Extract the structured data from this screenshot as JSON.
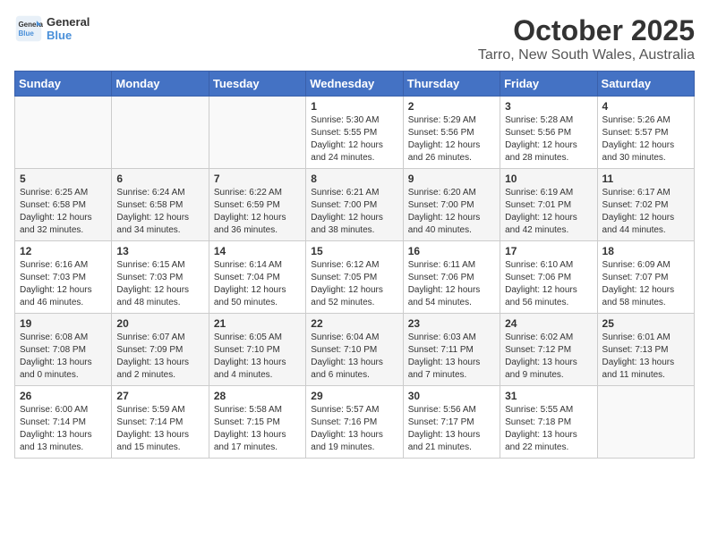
{
  "logo": {
    "text_general": "General",
    "text_blue": "Blue"
  },
  "title": "October 2025",
  "subtitle": "Tarro, New South Wales, Australia",
  "days_of_week": [
    "Sunday",
    "Monday",
    "Tuesday",
    "Wednesday",
    "Thursday",
    "Friday",
    "Saturday"
  ],
  "weeks": [
    [
      {
        "day": "",
        "info": ""
      },
      {
        "day": "",
        "info": ""
      },
      {
        "day": "",
        "info": ""
      },
      {
        "day": "1",
        "info": "Sunrise: 5:30 AM\nSunset: 5:55 PM\nDaylight: 12 hours\nand 24 minutes."
      },
      {
        "day": "2",
        "info": "Sunrise: 5:29 AM\nSunset: 5:56 PM\nDaylight: 12 hours\nand 26 minutes."
      },
      {
        "day": "3",
        "info": "Sunrise: 5:28 AM\nSunset: 5:56 PM\nDaylight: 12 hours\nand 28 minutes."
      },
      {
        "day": "4",
        "info": "Sunrise: 5:26 AM\nSunset: 5:57 PM\nDaylight: 12 hours\nand 30 minutes."
      }
    ],
    [
      {
        "day": "5",
        "info": "Sunrise: 6:25 AM\nSunset: 6:58 PM\nDaylight: 12 hours\nand 32 minutes."
      },
      {
        "day": "6",
        "info": "Sunrise: 6:24 AM\nSunset: 6:58 PM\nDaylight: 12 hours\nand 34 minutes."
      },
      {
        "day": "7",
        "info": "Sunrise: 6:22 AM\nSunset: 6:59 PM\nDaylight: 12 hours\nand 36 minutes."
      },
      {
        "day": "8",
        "info": "Sunrise: 6:21 AM\nSunset: 7:00 PM\nDaylight: 12 hours\nand 38 minutes."
      },
      {
        "day": "9",
        "info": "Sunrise: 6:20 AM\nSunset: 7:00 PM\nDaylight: 12 hours\nand 40 minutes."
      },
      {
        "day": "10",
        "info": "Sunrise: 6:19 AM\nSunset: 7:01 PM\nDaylight: 12 hours\nand 42 minutes."
      },
      {
        "day": "11",
        "info": "Sunrise: 6:17 AM\nSunset: 7:02 PM\nDaylight: 12 hours\nand 44 minutes."
      }
    ],
    [
      {
        "day": "12",
        "info": "Sunrise: 6:16 AM\nSunset: 7:03 PM\nDaylight: 12 hours\nand 46 minutes."
      },
      {
        "day": "13",
        "info": "Sunrise: 6:15 AM\nSunset: 7:03 PM\nDaylight: 12 hours\nand 48 minutes."
      },
      {
        "day": "14",
        "info": "Sunrise: 6:14 AM\nSunset: 7:04 PM\nDaylight: 12 hours\nand 50 minutes."
      },
      {
        "day": "15",
        "info": "Sunrise: 6:12 AM\nSunset: 7:05 PM\nDaylight: 12 hours\nand 52 minutes."
      },
      {
        "day": "16",
        "info": "Sunrise: 6:11 AM\nSunset: 7:06 PM\nDaylight: 12 hours\nand 54 minutes."
      },
      {
        "day": "17",
        "info": "Sunrise: 6:10 AM\nSunset: 7:06 PM\nDaylight: 12 hours\nand 56 minutes."
      },
      {
        "day": "18",
        "info": "Sunrise: 6:09 AM\nSunset: 7:07 PM\nDaylight: 12 hours\nand 58 minutes."
      }
    ],
    [
      {
        "day": "19",
        "info": "Sunrise: 6:08 AM\nSunset: 7:08 PM\nDaylight: 13 hours\nand 0 minutes."
      },
      {
        "day": "20",
        "info": "Sunrise: 6:07 AM\nSunset: 7:09 PM\nDaylight: 13 hours\nand 2 minutes."
      },
      {
        "day": "21",
        "info": "Sunrise: 6:05 AM\nSunset: 7:10 PM\nDaylight: 13 hours\nand 4 minutes."
      },
      {
        "day": "22",
        "info": "Sunrise: 6:04 AM\nSunset: 7:10 PM\nDaylight: 13 hours\nand 6 minutes."
      },
      {
        "day": "23",
        "info": "Sunrise: 6:03 AM\nSunset: 7:11 PM\nDaylight: 13 hours\nand 7 minutes."
      },
      {
        "day": "24",
        "info": "Sunrise: 6:02 AM\nSunset: 7:12 PM\nDaylight: 13 hours\nand 9 minutes."
      },
      {
        "day": "25",
        "info": "Sunrise: 6:01 AM\nSunset: 7:13 PM\nDaylight: 13 hours\nand 11 minutes."
      }
    ],
    [
      {
        "day": "26",
        "info": "Sunrise: 6:00 AM\nSunset: 7:14 PM\nDaylight: 13 hours\nand 13 minutes."
      },
      {
        "day": "27",
        "info": "Sunrise: 5:59 AM\nSunset: 7:14 PM\nDaylight: 13 hours\nand 15 minutes."
      },
      {
        "day": "28",
        "info": "Sunrise: 5:58 AM\nSunset: 7:15 PM\nDaylight: 13 hours\nand 17 minutes."
      },
      {
        "day": "29",
        "info": "Sunrise: 5:57 AM\nSunset: 7:16 PM\nDaylight: 13 hours\nand 19 minutes."
      },
      {
        "day": "30",
        "info": "Sunrise: 5:56 AM\nSunset: 7:17 PM\nDaylight: 13 hours\nand 21 minutes."
      },
      {
        "day": "31",
        "info": "Sunrise: 5:55 AM\nSunset: 7:18 PM\nDaylight: 13 hours\nand 22 minutes."
      },
      {
        "day": "",
        "info": ""
      }
    ]
  ]
}
